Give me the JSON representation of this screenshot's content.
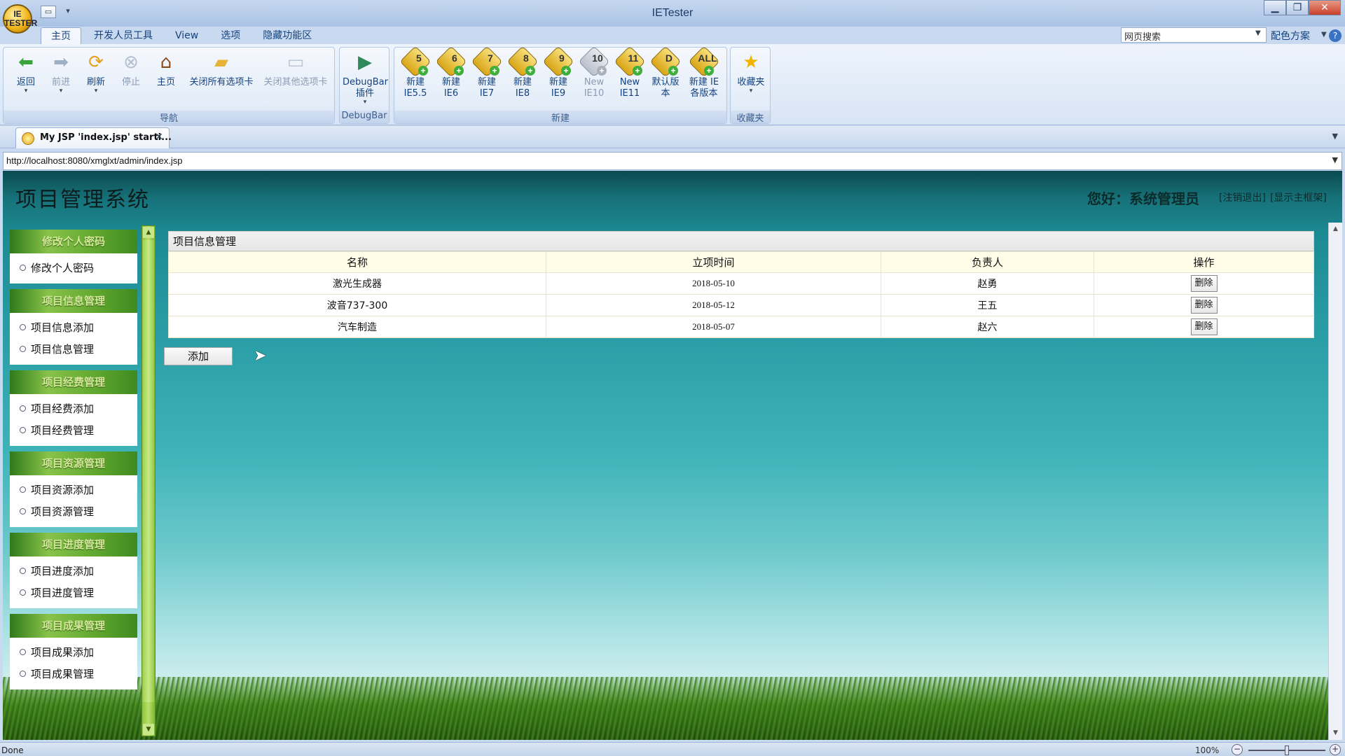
{
  "window": {
    "title": "IETester",
    "minimize": "▁",
    "maximize": "❐",
    "close": "✕"
  },
  "app_icon_text": "IE TESTER",
  "quick_access": [
    "▭",
    "▾"
  ],
  "ribbon_tabs": [
    "主页",
    "开发人员工具",
    "View",
    "选项",
    "隐藏功能区"
  ],
  "search": {
    "placeholder": "网页搜索",
    "scheme_label": "配色方案",
    "help": "?"
  },
  "groups": {
    "nav": {
      "label": "导航",
      "back": "返回",
      "forward": "前进",
      "refresh": "刷新",
      "stop": "停止",
      "home": "主页",
      "close_all": "关闭所有选项卡",
      "close_others": "关闭其他选项卡"
    },
    "debugbar": {
      "label": "DebugBar",
      "plugin_line1": "DebugBar",
      "plugin_line2": "插件"
    },
    "new": {
      "label": "新建",
      "items": [
        {
          "badge": "5",
          "l1": "新建",
          "l2": "IE5.5"
        },
        {
          "badge": "6",
          "l1": "新建",
          "l2": "IE6"
        },
        {
          "badge": "7",
          "l1": "新建",
          "l2": "IE7"
        },
        {
          "badge": "8",
          "l1": "新建",
          "l2": "IE8"
        },
        {
          "badge": "9",
          "l1": "新建",
          "l2": "IE9"
        },
        {
          "badge": "10",
          "l1": "New",
          "l2": "IE10"
        },
        {
          "badge": "11",
          "l1": "New",
          "l2": "IE11"
        },
        {
          "badge": "D",
          "l1": "默认版本",
          "l2": ""
        },
        {
          "badge": "ALL",
          "l1": "新建 IE",
          "l2": "各版本"
        }
      ]
    },
    "favorites": {
      "label": "收藏夹",
      "button": "收藏夹"
    }
  },
  "tab": {
    "title": "My JSP 'index.jsp' starti...",
    "close": "✕"
  },
  "address": "http://localhost:8080/xmglxt/admin/index.jsp",
  "site": {
    "title": "项目管理系统",
    "greeting": "您好：系统管理员",
    "logout": "[注销退出]",
    "show_frame": "[显示主框架]"
  },
  "sidebar": [
    {
      "header": "修改个人密码",
      "items": [
        "修改个人密码"
      ]
    },
    {
      "header": "项目信息管理",
      "items": [
        "项目信息添加",
        "项目信息管理"
      ]
    },
    {
      "header": "项目经费管理",
      "items": [
        "项目经费添加",
        "项目经费管理"
      ]
    },
    {
      "header": "项目资源管理",
      "items": [
        "项目资源添加",
        "项目资源管理"
      ]
    },
    {
      "header": "项目进度管理",
      "items": [
        "项目进度添加",
        "项目进度管理"
      ]
    },
    {
      "header": "项目成果管理",
      "items": [
        "项目成果添加",
        "项目成果管理"
      ]
    }
  ],
  "panel": {
    "title": "项目信息管理",
    "columns": [
      "名称",
      "立项时间",
      "负责人",
      "操作"
    ],
    "rows": [
      {
        "name": "激光生成器",
        "date": "2018-05-10",
        "owner": "赵勇",
        "action": "删除"
      },
      {
        "name": "波音737-300",
        "date": "2018-05-12",
        "owner": "王五",
        "action": "删除"
      },
      {
        "name": "汽车制造",
        "date": "2018-05-07",
        "owner": "赵六",
        "action": "删除"
      }
    ],
    "add_button": "添加"
  },
  "status": {
    "text": "Done",
    "zoom": "100%"
  }
}
